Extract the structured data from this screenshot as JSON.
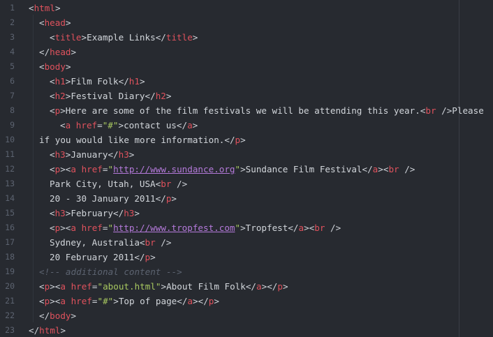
{
  "editor": {
    "lines": [
      {
        "n": "1",
        "indent": 0,
        "tokens": [
          [
            "punc",
            "<"
          ],
          [
            "tag",
            "html"
          ],
          [
            "punc",
            ">"
          ]
        ]
      },
      {
        "n": "2",
        "indent": 1,
        "tokens": [
          [
            "punc",
            "<"
          ],
          [
            "tag",
            "head"
          ],
          [
            "punc",
            ">"
          ]
        ]
      },
      {
        "n": "3",
        "indent": 2,
        "tokens": [
          [
            "punc",
            "<"
          ],
          [
            "tag",
            "title"
          ],
          [
            "punc",
            ">"
          ],
          [
            "txt",
            "Example Links"
          ],
          [
            "punc",
            "</"
          ],
          [
            "tag",
            "title"
          ],
          [
            "punc",
            ">"
          ]
        ]
      },
      {
        "n": "4",
        "indent": 1,
        "tokens": [
          [
            "punc",
            "</"
          ],
          [
            "tag",
            "head"
          ],
          [
            "punc",
            ">"
          ]
        ]
      },
      {
        "n": "5",
        "indent": 1,
        "tokens": [
          [
            "punc",
            "<"
          ],
          [
            "tag",
            "body"
          ],
          [
            "punc",
            ">"
          ]
        ]
      },
      {
        "n": "6",
        "indent": 2,
        "tokens": [
          [
            "punc",
            "<"
          ],
          [
            "tag",
            "h1"
          ],
          [
            "punc",
            ">"
          ],
          [
            "txt",
            "Film Folk"
          ],
          [
            "punc",
            "</"
          ],
          [
            "tag",
            "h1"
          ],
          [
            "punc",
            ">"
          ]
        ]
      },
      {
        "n": "7",
        "indent": 2,
        "tokens": [
          [
            "punc",
            "<"
          ],
          [
            "tag",
            "h2"
          ],
          [
            "punc",
            ">"
          ],
          [
            "txt",
            "Festival Diary"
          ],
          [
            "punc",
            "</"
          ],
          [
            "tag",
            "h2"
          ],
          [
            "punc",
            ">"
          ]
        ]
      },
      {
        "n": "8",
        "indent": 2,
        "tokens": [
          [
            "punc",
            "<"
          ],
          [
            "tag",
            "p"
          ],
          [
            "punc",
            ">"
          ],
          [
            "txt",
            "Here are some of the film festivals we will be attending this year."
          ],
          [
            "punc",
            "<"
          ],
          [
            "tag",
            "br"
          ],
          [
            "punc",
            " />"
          ],
          [
            "txt",
            "Please"
          ]
        ]
      },
      {
        "n": "9",
        "indent": 3,
        "tokens": [
          [
            "punc",
            "<"
          ],
          [
            "tag",
            "a"
          ],
          [
            "punc",
            " "
          ],
          [
            "attr",
            "href"
          ],
          [
            "punc",
            "="
          ],
          [
            "str",
            "\"#\""
          ],
          [
            "punc",
            ">"
          ],
          [
            "txt",
            "contact us"
          ],
          [
            "punc",
            "</"
          ],
          [
            "tag",
            "a"
          ],
          [
            "punc",
            ">"
          ]
        ]
      },
      {
        "n": "10",
        "indent": 1,
        "tokens": [
          [
            "txt",
            "if you would like more information."
          ],
          [
            "punc",
            "</"
          ],
          [
            "tag",
            "p"
          ],
          [
            "punc",
            ">"
          ]
        ]
      },
      {
        "n": "11",
        "indent": 2,
        "tokens": [
          [
            "punc",
            "<"
          ],
          [
            "tag",
            "h3"
          ],
          [
            "punc",
            ">"
          ],
          [
            "txt",
            "January"
          ],
          [
            "punc",
            "</"
          ],
          [
            "tag",
            "h3"
          ],
          [
            "punc",
            ">"
          ]
        ]
      },
      {
        "n": "12",
        "indent": 2,
        "tokens": [
          [
            "punc",
            "<"
          ],
          [
            "tag",
            "p"
          ],
          [
            "punc",
            ">"
          ],
          [
            "punc",
            "<"
          ],
          [
            "tag",
            "a"
          ],
          [
            "punc",
            " "
          ],
          [
            "attr",
            "href"
          ],
          [
            "punc",
            "="
          ],
          [
            "str",
            "\""
          ],
          [
            "url",
            "http://www.sundance.org"
          ],
          [
            "str",
            "\""
          ],
          [
            "punc",
            ">"
          ],
          [
            "txt",
            "Sundance Film Festival"
          ],
          [
            "punc",
            "</"
          ],
          [
            "tag",
            "a"
          ],
          [
            "punc",
            ">"
          ],
          [
            "punc",
            "<"
          ],
          [
            "tag",
            "br"
          ],
          [
            "punc",
            " />"
          ]
        ]
      },
      {
        "n": "13",
        "indent": 2,
        "tokens": [
          [
            "txt",
            "Park City, Utah, USA"
          ],
          [
            "punc",
            "<"
          ],
          [
            "tag",
            "br"
          ],
          [
            "punc",
            " />"
          ]
        ]
      },
      {
        "n": "14",
        "indent": 2,
        "tokens": [
          [
            "txt",
            "20 - 30 January 2011"
          ],
          [
            "punc",
            "</"
          ],
          [
            "tag",
            "p"
          ],
          [
            "punc",
            ">"
          ]
        ]
      },
      {
        "n": "15",
        "indent": 2,
        "tokens": [
          [
            "punc",
            "<"
          ],
          [
            "tag",
            "h3"
          ],
          [
            "punc",
            ">"
          ],
          [
            "txt",
            "February"
          ],
          [
            "punc",
            "</"
          ],
          [
            "tag",
            "h3"
          ],
          [
            "punc",
            ">"
          ]
        ]
      },
      {
        "n": "16",
        "indent": 2,
        "tokens": [
          [
            "punc",
            "<"
          ],
          [
            "tag",
            "p"
          ],
          [
            "punc",
            ">"
          ],
          [
            "punc",
            "<"
          ],
          [
            "tag",
            "a"
          ],
          [
            "punc",
            " "
          ],
          [
            "attr",
            "href"
          ],
          [
            "punc",
            "="
          ],
          [
            "str",
            "\""
          ],
          [
            "url",
            "http://www.tropfest.com"
          ],
          [
            "str",
            "\""
          ],
          [
            "punc",
            ">"
          ],
          [
            "txt",
            "Tropfest"
          ],
          [
            "punc",
            "</"
          ],
          [
            "tag",
            "a"
          ],
          [
            "punc",
            ">"
          ],
          [
            "punc",
            "<"
          ],
          [
            "tag",
            "br"
          ],
          [
            "punc",
            " />"
          ]
        ]
      },
      {
        "n": "17",
        "indent": 2,
        "tokens": [
          [
            "txt",
            "Sydney, Australia"
          ],
          [
            "punc",
            "<"
          ],
          [
            "tag",
            "br"
          ],
          [
            "punc",
            " />"
          ]
        ]
      },
      {
        "n": "18",
        "indent": 2,
        "tokens": [
          [
            "txt",
            "20 February 2011"
          ],
          [
            "punc",
            "</"
          ],
          [
            "tag",
            "p"
          ],
          [
            "punc",
            ">"
          ]
        ]
      },
      {
        "n": "19",
        "indent": 1,
        "tokens": [
          [
            "cmt",
            "<!-- additional content -->"
          ]
        ]
      },
      {
        "n": "20",
        "indent": 1,
        "tokens": [
          [
            "punc",
            "<"
          ],
          [
            "tag",
            "p"
          ],
          [
            "punc",
            ">"
          ],
          [
            "punc",
            "<"
          ],
          [
            "tag",
            "a"
          ],
          [
            "punc",
            " "
          ],
          [
            "attr",
            "href"
          ],
          [
            "punc",
            "="
          ],
          [
            "str",
            "\"about.html\""
          ],
          [
            "punc",
            ">"
          ],
          [
            "txt",
            "About Film Folk"
          ],
          [
            "punc",
            "</"
          ],
          [
            "tag",
            "a"
          ],
          [
            "punc",
            ">"
          ],
          [
            "punc",
            "</"
          ],
          [
            "tag",
            "p"
          ],
          [
            "punc",
            ">"
          ]
        ]
      },
      {
        "n": "21",
        "indent": 1,
        "tokens": [
          [
            "punc",
            "<"
          ],
          [
            "tag",
            "p"
          ],
          [
            "punc",
            ">"
          ],
          [
            "punc",
            "<"
          ],
          [
            "tag",
            "a"
          ],
          [
            "punc",
            " "
          ],
          [
            "attr",
            "href"
          ],
          [
            "punc",
            "="
          ],
          [
            "str",
            "\"#\""
          ],
          [
            "punc",
            ">"
          ],
          [
            "txt",
            "Top of page"
          ],
          [
            "punc",
            "</"
          ],
          [
            "tag",
            "a"
          ],
          [
            "punc",
            ">"
          ],
          [
            "punc",
            "</"
          ],
          [
            "tag",
            "p"
          ],
          [
            "punc",
            ">"
          ]
        ]
      },
      {
        "n": "22",
        "indent": 1,
        "tokens": [
          [
            "punc",
            "</"
          ],
          [
            "tag",
            "body"
          ],
          [
            "punc",
            ">"
          ]
        ]
      },
      {
        "n": "23",
        "indent": 0,
        "tokens": [
          [
            "punc",
            "</"
          ],
          [
            "tag",
            "html"
          ],
          [
            "punc",
            ">"
          ]
        ]
      }
    ]
  },
  "colors": {
    "background": "#272a30",
    "tag": "#e0525d",
    "string": "#a8c860",
    "url": "#b57adb",
    "text": "#d2d6db",
    "line_number": "#5c6370",
    "comment": "#5c6370"
  }
}
